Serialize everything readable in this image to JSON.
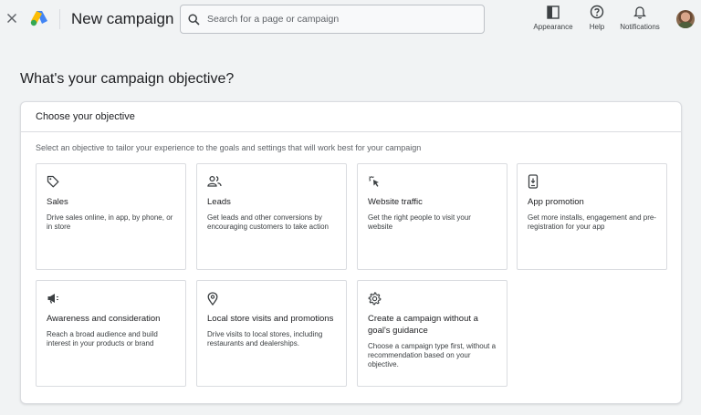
{
  "header": {
    "title": "New campaign",
    "search_placeholder": "Search for a page or campaign",
    "actions": [
      {
        "label": "Appearance",
        "icon": "appearance-icon"
      },
      {
        "label": "Help",
        "icon": "help-icon"
      },
      {
        "label": "Notifications",
        "icon": "bell-icon"
      }
    ]
  },
  "page": {
    "heading": "What's your campaign objective?"
  },
  "card": {
    "title": "Choose your objective",
    "subtitle": "Select an objective to tailor your experience to the goals and settings that will work best for your campaign",
    "objectives": [
      {
        "name": "Sales",
        "description": "Drive sales online, in app, by phone, or in store",
        "icon": "tag-icon"
      },
      {
        "name": "Leads",
        "description": "Get leads and other conversions by encouraging customers to take action",
        "icon": "people-icon"
      },
      {
        "name": "Website traffic",
        "description": "Get the right people to visit your website",
        "icon": "cursor-click-icon"
      },
      {
        "name": "App promotion",
        "description": "Get more installs, engagement and pre-registration for your app",
        "icon": "phone-icon"
      },
      {
        "name": "Awareness and consideration",
        "description": "Reach a broad audience and build interest in your products or brand",
        "icon": "megaphone-icon"
      },
      {
        "name": "Local store visits and promotions",
        "description": "Drive visits to local stores, including restaurants and dealerships.",
        "icon": "location-pin-icon"
      },
      {
        "name": "Create a campaign without a goal's guidance",
        "description": "Choose a campaign type first, without a recommendation based on your objective.",
        "icon": "gear-icon"
      }
    ]
  },
  "colors": {
    "background": "#f1f3f4",
    "card": "#ffffff",
    "border": "#dadce0",
    "text_primary": "#202124",
    "text_secondary": "#5f6368",
    "logo_blue": "#4285f4",
    "logo_yellow": "#fbbc04",
    "logo_green": "#34a853"
  }
}
